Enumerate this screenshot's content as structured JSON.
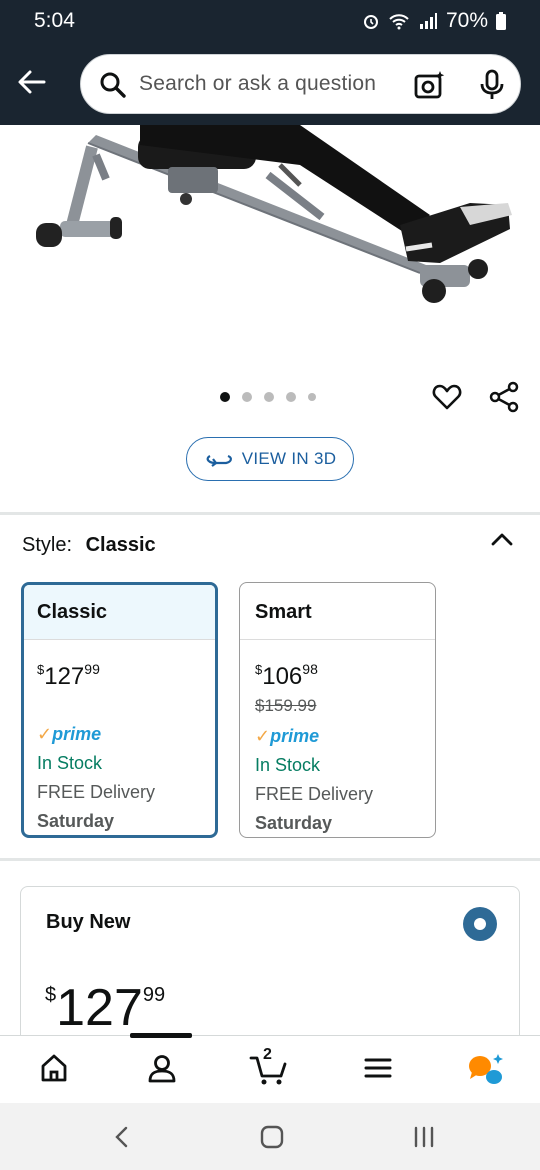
{
  "status": {
    "time": "5:04",
    "battery": "70%"
  },
  "search": {
    "placeholder": "Search or ask a question"
  },
  "gallery": {
    "dots": 5,
    "active_index": 0,
    "view3d_label": "VIEW IN 3D"
  },
  "style": {
    "label": "Style:",
    "value": "Classic"
  },
  "options": [
    {
      "name": "Classic",
      "price_whole": "127",
      "price_cents": "99",
      "list_price": "",
      "prime": "prime",
      "stock": "In Stock",
      "delivery": "FREE Delivery",
      "day": "Saturday",
      "selected": true
    },
    {
      "name": "Smart",
      "price_whole": "106",
      "price_cents": "98",
      "list_price": "$159.99",
      "prime": "prime",
      "stock": "In Stock",
      "delivery": "FREE Delivery",
      "day": "Saturday",
      "selected": false
    }
  ],
  "buy": {
    "title": "Buy New",
    "currency": "$",
    "price_whole": "127",
    "price_cents": "99"
  },
  "cart": {
    "count": "2"
  },
  "colors": {
    "header": "#1a2530",
    "link_blue": "#1b5e9e",
    "selected_border": "#2e6a96",
    "in_stock": "#067d62",
    "prime_blue": "#1f9ad6"
  }
}
